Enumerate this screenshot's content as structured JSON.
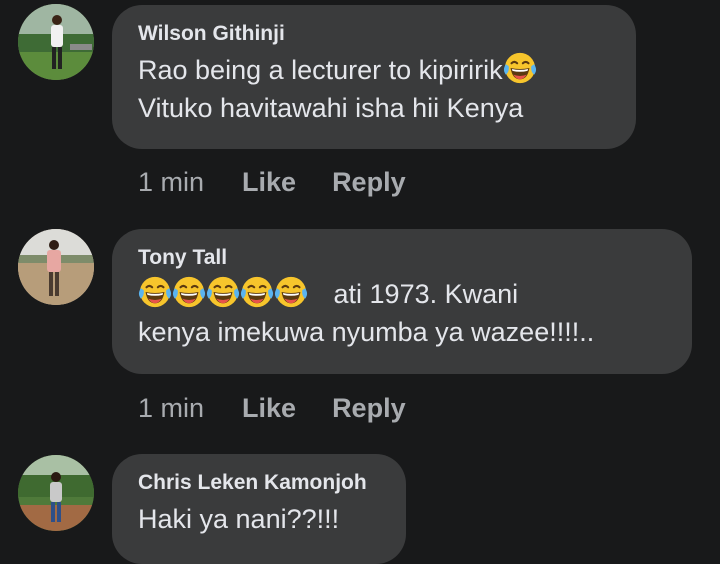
{
  "comments": [
    {
      "author": "Wilson Githinji",
      "line1": "Rao being a lecturer to kipiririk",
      "line2": "Vituko havitawahi isha hii Kenya",
      "time": "1 min",
      "like": "Like",
      "reply": "Reply",
      "emoji_icon": "face-with-tears-of-joy-icon"
    },
    {
      "author": "Tony Tall",
      "line1_suffix": "ati  1973. Kwani",
      "line2": "kenya imekuwa nyumba ya wazee!!!!..",
      "time": "1 min",
      "like": "Like",
      "reply": "Reply",
      "emoji_icon": "face-with-tears-of-joy-icon",
      "emoji_count": 5
    },
    {
      "author": "Chris Leken Kamonjoh",
      "line1": "Haki ya nani??!!!"
    }
  ],
  "colors": {
    "background": "#18191a",
    "bubble": "#3a3b3c",
    "primary_text": "#e4e6eb",
    "secondary_text": "#a8abaf"
  }
}
